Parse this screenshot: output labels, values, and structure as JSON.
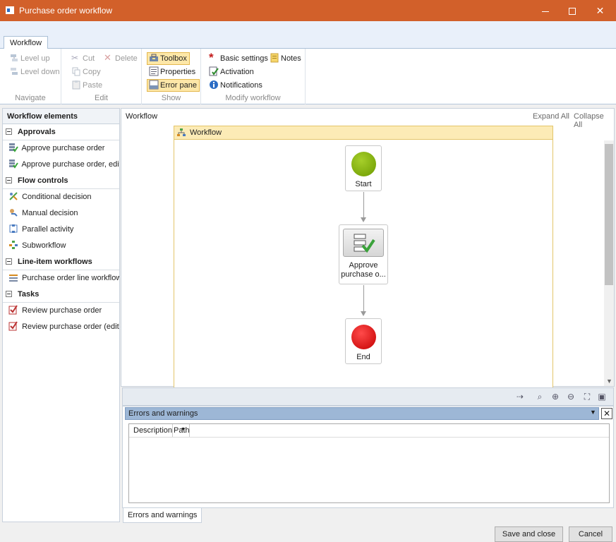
{
  "window": {
    "title": "Purchase order workflow",
    "controls": {
      "minimize": "—",
      "maximize": "☐",
      "close": "✕"
    }
  },
  "ribbon": {
    "tab": "Workflow",
    "groups": {
      "navigate": {
        "label": "Navigate",
        "level_up": "Level up",
        "level_down": "Level down"
      },
      "edit": {
        "label": "Edit",
        "cut": "Cut",
        "copy": "Copy",
        "paste": "Paste",
        "delete": "Delete"
      },
      "show": {
        "label": "Show",
        "toolbox": "Toolbox",
        "properties": "Properties",
        "error_pane": "Error pane"
      },
      "modify": {
        "label": "Modify workflow",
        "basic_settings": "Basic settings",
        "notes": "Notes",
        "activation": "Activation",
        "notifications": "Notifications"
      }
    }
  },
  "toolbox": {
    "header": "Workflow elements",
    "categories": [
      {
        "label": "Approvals",
        "items": [
          "Approve purchase order",
          "Approve purchase order, edita"
        ]
      },
      {
        "label": "Flow controls",
        "items": [
          "Conditional decision",
          "Manual decision",
          "Parallel activity",
          "Subworkflow"
        ]
      },
      {
        "label": "Line-item workflows",
        "items": [
          "Purchase order line workflow"
        ]
      },
      {
        "label": "Tasks",
        "items": [
          "Review purchase order",
          "Review purchase order (editab"
        ]
      }
    ]
  },
  "designer": {
    "breadcrumb": "Workflow",
    "expand_all": "Expand All",
    "collapse_all": "Collapse All",
    "frame_title": "Workflow",
    "nodes": {
      "start": {
        "label": "Start",
        "color": "#76a800"
      },
      "approve": {
        "line1": "Approve",
        "line2": "purchase o..."
      },
      "end": {
        "label": "End",
        "color": "#dd0000"
      }
    }
  },
  "error_pane": {
    "title": "Errors and warnings",
    "columns": [
      "Description",
      "Path"
    ],
    "tab": "Errors and warnings"
  },
  "footer": {
    "save_close": "Save and close",
    "cancel": "Cancel"
  },
  "colors": {
    "titlebar": "#d2602a",
    "active_button": "#fde7a8",
    "frame_border": "#e3c56a"
  }
}
